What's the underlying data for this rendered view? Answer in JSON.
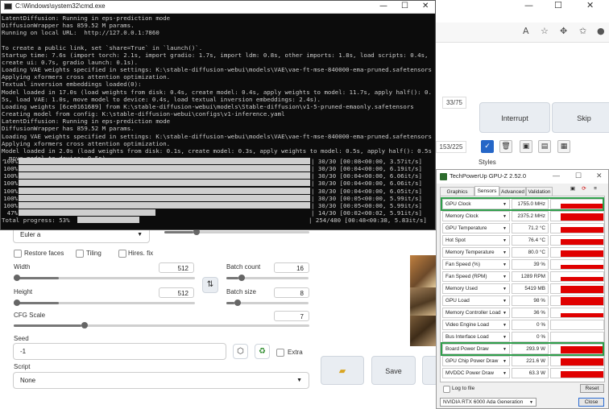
{
  "browser": {
    "counter_top": "33/75",
    "counter_bottom": "153/225",
    "interrupt_label": "Interrupt",
    "skip_label": "Skip",
    "styles_label": "Styles",
    "save_label": "Save"
  },
  "webui": {
    "sampler": "Euler a",
    "restore_faces": "Restore faces",
    "tiling": "Tiling",
    "hires_fix": "Hires. fix",
    "width_label": "Width",
    "width_value": "512",
    "height_label": "Height",
    "height_value": "512",
    "batch_count_label": "Batch count",
    "batch_count_value": "16",
    "batch_size_label": "Batch size",
    "batch_size_value": "8",
    "cfg_label": "CFG Scale",
    "cfg_value": "7",
    "seed_label": "Seed",
    "seed_value": "-1",
    "extra_label": "Extra",
    "script_label": "Script",
    "script_value": "None"
  },
  "cmd": {
    "title": "C:\\Windows\\system32\\cmd.exe",
    "log": "LatentDiffusion: Running in eps-prediction mode\nDiffusionWrapper has 859.52 M params.\nRunning on local URL:  http://127.0.0.1:7860\n\nTo create a public link, set `share=True` in `launch()`.\nStartup time: 7.6s (import torch: 2.1s, import gradio: 1.7s, import ldm: 0.8s, other imports: 1.8s, load scripts: 0.4s,\ncreate ui: 0.7s, gradio launch: 0.1s).\nLoading VAE weights specified in settings: K:\\stable-diffusion-webui\\models\\VAE\\vae-ft-mse-840000-ema-pruned.safetensors\nApplying xformers cross attention optimization.\nTextual inversion embeddings loaded(0):\nModel loaded in 17.0s (load weights from disk: 0.4s, create model: 0.4s, apply weights to model: 11.7s, apply half(): 0.\n5s, load VAE: 1.0s, move model to device: 0.4s, load textual inversion embeddings: 2.4s).\nLoading weights [6ce0161689] from K:\\stable-diffusion-webui\\models\\Stable-diffusion\\v1-5-pruned-emaonly.safetensors\nCreating model from config: K:\\stable-diffusion-webui\\configs\\v1-inference.yaml\nLatentDiffusion: Running in eps-prediction mode\nDiffusionWrapper has 859.52 M params.\nLoading VAE weights specified in settings: K:\\stable-diffusion-webui\\models\\VAE\\vae-ft-mse-840000-ema-pruned.safetensors\nApplying xformers cross attention optimization.\nModel loaded in 2.0s (load weights from disk: 0.1s, create model: 0.3s, apply weights to model: 0.5s, apply half(): 0.5s\n, move model to device: 0.5s).",
    "progress": [
      {
        "pct": "100%",
        "fill": 1.0,
        "tail": "| 30/30 [00:08<00:00,  3.57it/s]"
      },
      {
        "pct": "100%",
        "fill": 1.0,
        "tail": "| 30/30 [00:04<00:00,  6.19it/s]"
      },
      {
        "pct": "100%",
        "fill": 1.0,
        "tail": "| 30/30 [00:04<00:00,  6.06it/s]"
      },
      {
        "pct": "100%",
        "fill": 1.0,
        "tail": "| 30/30 [00:04<00:00,  6.06it/s]"
      },
      {
        "pct": "100%",
        "fill": 1.0,
        "tail": "| 30/30 [00:04<00:00,  6.05it/s]"
      },
      {
        "pct": "100%",
        "fill": 1.0,
        "tail": "| 30/30 [00:05<00:00,  5.99it/s]"
      },
      {
        "pct": "100%",
        "fill": 1.0,
        "tail": "| 30/30 [00:05<00:00,  5.99it/s]"
      },
      {
        "pct": "47%",
        "fill": 0.47,
        "tail": "| 14/30 [00:02<00:02,  5.91it/s]"
      }
    ],
    "total_label": "Total progress:  53%",
    "total_fill": 0.53,
    "total_tail": "| 254/480 [00:48<00:38,  5.83it/s]"
  },
  "gpuz": {
    "title": "TechPowerUp GPU-Z 2.52.0",
    "tabs": [
      "Graphics Card",
      "Sensors",
      "Advanced",
      "Validation"
    ],
    "active_tab": 1,
    "sensors": [
      {
        "name": "GPU Clock",
        "value": "1755.0 MHz",
        "level": 0.55,
        "highlight": true
      },
      {
        "name": "Memory Clock",
        "value": "2375.2 MHz",
        "level": 0.85
      },
      {
        "name": "GPU Temperature",
        "value": "71.2 °C",
        "level": 0.6
      },
      {
        "name": "Hot Spot",
        "value": "76.4 °C",
        "level": 0.65
      },
      {
        "name": "Memory Temperature",
        "value": "80.0 °C",
        "level": 0.7
      },
      {
        "name": "Fan Speed (%)",
        "value": "39 %",
        "level": 0.45
      },
      {
        "name": "Fan Speed (RPM)",
        "value": "1289 RPM",
        "level": 0.45
      },
      {
        "name": "Memory Used",
        "value": "5419 MB",
        "level": 0.8
      },
      {
        "name": "GPU Load",
        "value": "98 %",
        "level": 0.9
      },
      {
        "name": "Memory Controller Load",
        "value": "36 %",
        "level": 0.5
      },
      {
        "name": "Video Engine Load",
        "value": "0 %",
        "level": 0.0
      },
      {
        "name": "Bus Interface Load",
        "value": "0 %",
        "level": 0.0
      },
      {
        "name": "Board Power Draw",
        "value": "293.9 W",
        "level": 0.85,
        "highlight": true
      },
      {
        "name": "GPU Chip Power Draw",
        "value": "221.6 W",
        "level": 0.8
      },
      {
        "name": "MVDDC Power Draw",
        "value": "63.3 W",
        "level": 0.75
      }
    ],
    "log_to_file": "Log to file",
    "reset_label": "Reset",
    "device": "NVIDIA RTX 6000 Ada Generation",
    "close_label": "Close"
  }
}
